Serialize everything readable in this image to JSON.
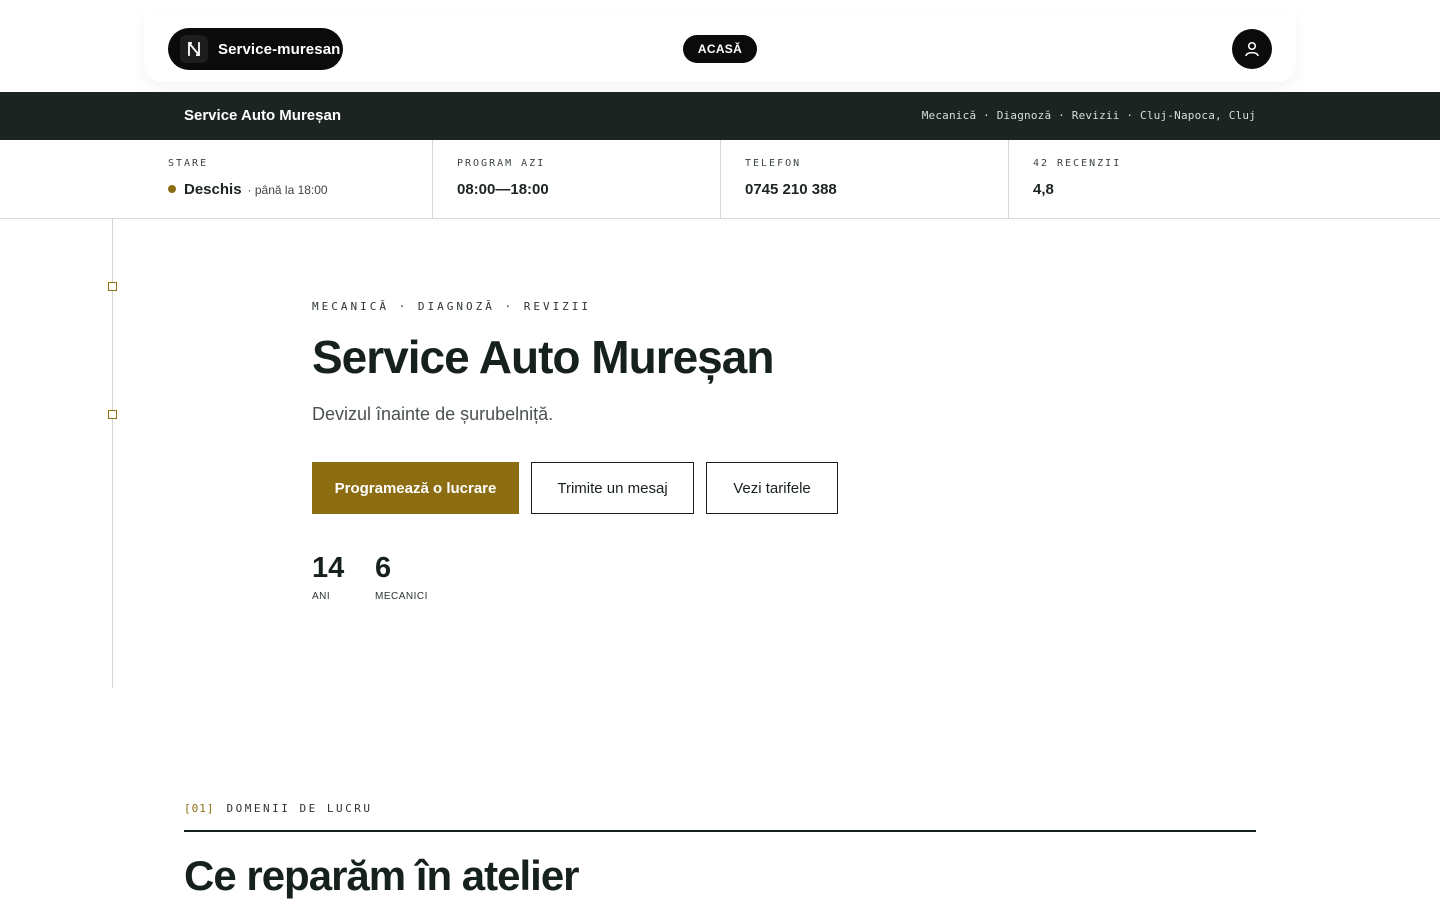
{
  "nav": {
    "brand_label": "Service-muresan",
    "home_label": "ACASĂ",
    "logo_icon": "n-logo-icon",
    "user_icon": "user-icon"
  },
  "strip": {
    "title": "Service Auto Mureșan",
    "meta": "Mecanică · Diagnoză · Revizii · Cluj-Napoca, Cluj"
  },
  "stats": {
    "status_label": "STARE",
    "status_value": "Deschis",
    "status_sub": "· până la 18:00",
    "schedule_label": "PROGRAM AZI",
    "schedule_value": "08:00—18:00",
    "phone_label": "TELEFON",
    "phone_value": "0745 210 388",
    "reviews_label": "42 RECENZII",
    "reviews_value": "4,8"
  },
  "hero": {
    "eyebrow": "MECANICĂ · DIAGNOZĂ · REVIZII",
    "title": "Service Auto Mureșan",
    "subtitle": "Devizul înainte de șurubelniță.",
    "btn_primary": "Programează o lucrare",
    "btn_message": "Trimite un mesaj",
    "btn_prices": "Vezi tarifele",
    "metrics": [
      {
        "value": "14",
        "label": "ANI"
      },
      {
        "value": "6",
        "label": "MECANICI"
      }
    ]
  },
  "section": {
    "number": "[01]",
    "tag": "DOMENII DE LUCRU",
    "title": "Ce reparăm în atelier"
  },
  "colors": {
    "accent": "#8c6d12",
    "dark": "#1b2420",
    "black": "#0b0b0b"
  }
}
